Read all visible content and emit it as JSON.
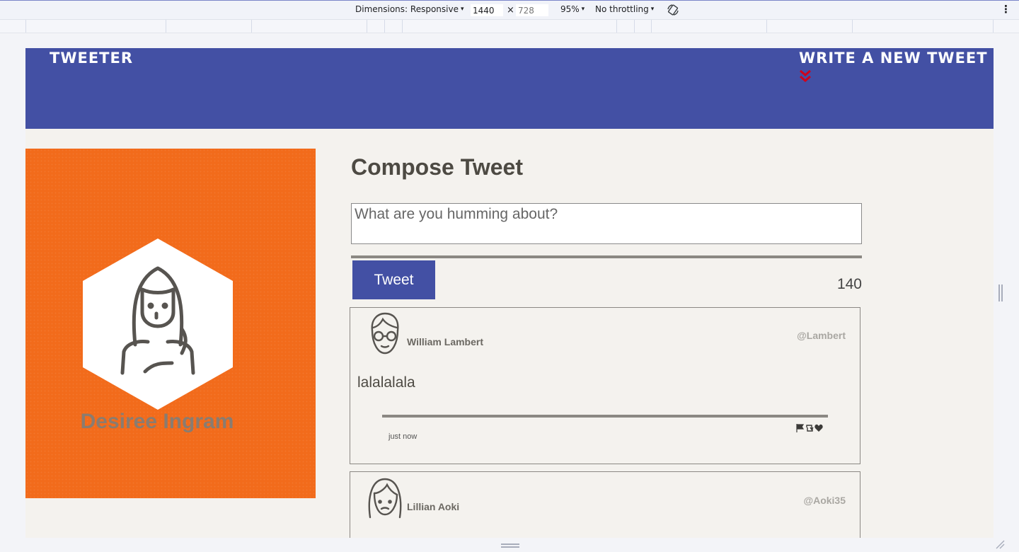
{
  "devtools": {
    "dimensions_label": "Dimensions: Responsive",
    "width": "1440",
    "height": "728",
    "times": "×",
    "zoom": "95%",
    "throttling": "No throttling",
    "caret": "▾",
    "kebab": "⋮"
  },
  "navbar": {
    "brand": "Tweeter",
    "write_new": "Write a new tweet",
    "accent_color": "#4350a4",
    "chevron_color": "#d0021b"
  },
  "profile": {
    "name": "Desiree Ingram",
    "background_color": "#f26b1b"
  },
  "compose": {
    "title": "Compose Tweet",
    "placeholder": "What are you humming about?",
    "button_label": "Tweet",
    "counter": "140"
  },
  "tweets": [
    {
      "name": "William Lambert",
      "handle": "@Lambert",
      "content": "lalalalala",
      "time": "just now",
      "avatar_icon": "man-with-glasses-avatar-icon"
    },
    {
      "name": "Lillian Aoki",
      "handle": "@Aoki35",
      "avatar_icon": "woman-avatar-icon"
    }
  ],
  "icons": {
    "flag": "flag-icon",
    "retweet": "retweet-icon",
    "like": "heart-icon"
  }
}
